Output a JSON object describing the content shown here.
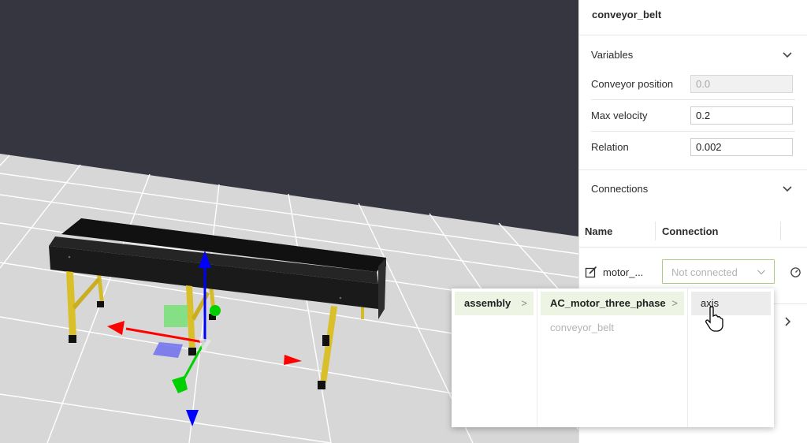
{
  "panel": {
    "title": "conveyor_belt",
    "variables": {
      "title": "Variables",
      "rows": [
        {
          "label": "Conveyor position",
          "value": "0.0",
          "disabled": true
        },
        {
          "label": "Max velocity",
          "value": "0.2",
          "disabled": false
        },
        {
          "label": "Relation",
          "value": "0.002",
          "disabled": false
        }
      ]
    },
    "connections": {
      "title": "Connections",
      "col_name": "Name",
      "col_connection": "Connection",
      "row_name": "motor_...",
      "row_placeholder": "Not connected"
    }
  },
  "dropdown": {
    "col1": [
      {
        "label": "assembly",
        "arrow": ">"
      }
    ],
    "col2": [
      {
        "label": "AC_motor_three_phase",
        "arrow": ">"
      },
      {
        "label": "conveyor_belt"
      }
    ],
    "col3": [
      {
        "label": "axis"
      }
    ]
  },
  "icons": {
    "edit": "edit-icon",
    "gauge": "gauge-icon",
    "chevron_down": "chevron-down-icon",
    "chevron_right": "chevron-right-icon",
    "cursor": "hand-cursor-icon"
  },
  "colors": {
    "sky": "#363641",
    "floor": "#d7d7d7",
    "belt": "#1b1b1b",
    "legs": "#d9c02a",
    "gizmo_x": "#ff0000",
    "gizmo_y": "#0000ff",
    "gizmo_z": "#00cc00",
    "select_border": "#a8cc86",
    "active_item": "#eef4e4"
  }
}
